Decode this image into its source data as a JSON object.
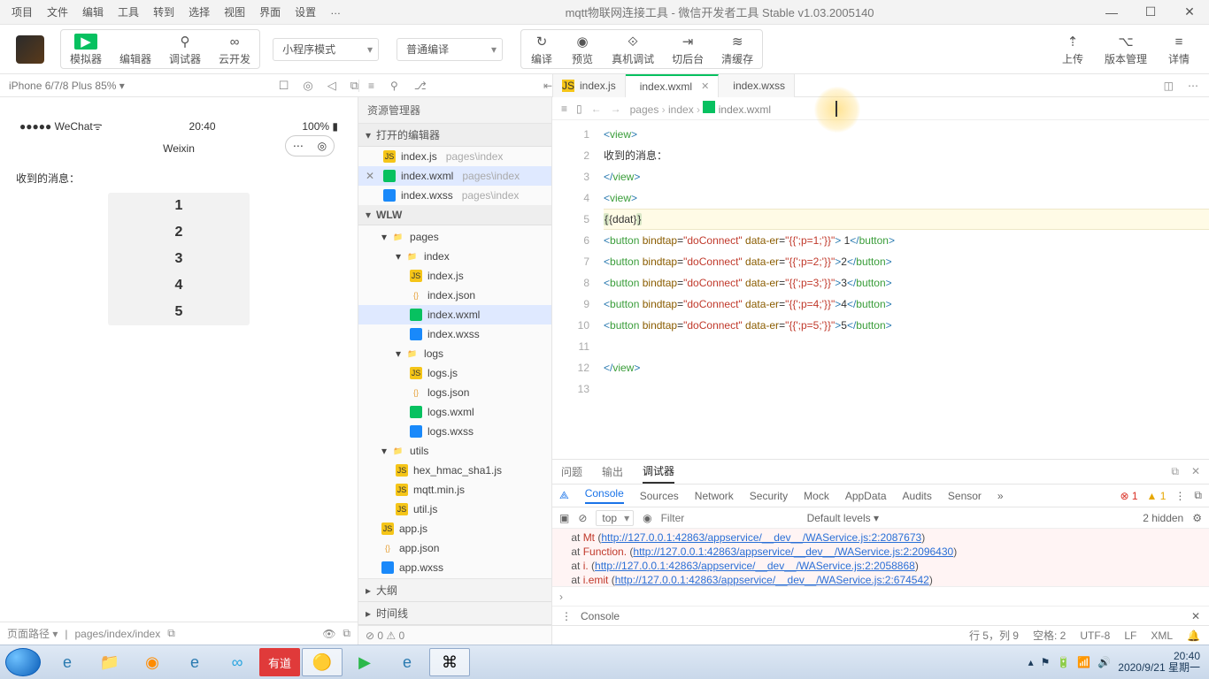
{
  "menu": [
    "项目",
    "文件",
    "编辑",
    "工具",
    "转到",
    "选择",
    "视图",
    "界面",
    "设置",
    "…"
  ],
  "window_title": "mqtt物联网连接工具 - 微信开发者工具 Stable v1.03.2005140",
  "toolbar_main": [
    {
      "icon": "▶",
      "label": "模拟器",
      "green": true
    },
    {
      "icon": "</>",
      "label": "编辑器"
    },
    {
      "icon": "⚲",
      "label": "调试器"
    },
    {
      "icon": "∞",
      "label": "云开发"
    }
  ],
  "combo_mode": "小程序模式",
  "combo_compile": "普通编译",
  "toolbar_mid": [
    {
      "icon": "↻",
      "label": "编译"
    },
    {
      "icon": "◉",
      "label": "预览"
    },
    {
      "icon": "⟐",
      "label": "真机调试"
    },
    {
      "icon": "⇥",
      "label": "切后台"
    },
    {
      "icon": "≋",
      "label": "清缓存"
    }
  ],
  "toolbar_right": [
    {
      "icon": "⇡",
      "label": "上传"
    },
    {
      "icon": "⌥",
      "label": "版本管理"
    },
    {
      "icon": "≡",
      "label": "详情"
    }
  ],
  "device": "iPhone 6/7/8 Plus 85% ▾",
  "tabs": [
    {
      "name": "index.js",
      "icon": "js",
      "active": false,
      "close": false
    },
    {
      "name": "index.wxml",
      "icon": "wxml",
      "active": true,
      "close": true
    },
    {
      "name": "index.wxss",
      "icon": "wxss",
      "active": false,
      "close": false
    }
  ],
  "sim": {
    "signal": "●●●●●",
    "carrier": "WeChat",
    "wifi": "ᯤ",
    "time": "20:40",
    "battery": "100%",
    "batt_icon": "▮▮",
    "title": "Weixin",
    "body_label": "收到的消息：",
    "buttons": [
      "1",
      "2",
      "3",
      "4",
      "5"
    ]
  },
  "page_path_label": "页面路径 ▾",
  "page_path": "pages/index/index",
  "explorer": {
    "title": "资源管理器",
    "open_editors": "打开的编辑器",
    "open_items": [
      {
        "name": "index.js",
        "icon": "js",
        "path": "pages\\index"
      },
      {
        "name": "index.wxml",
        "icon": "wxml",
        "path": "pages\\index",
        "sel": true,
        "close": true
      },
      {
        "name": "index.wxss",
        "icon": "wxss",
        "path": "pages\\index"
      }
    ],
    "project": "WLW",
    "outline": "大纲",
    "timeline": "时间线",
    "status": "⊘ 0 ⚠ 0"
  },
  "tree": [
    {
      "d": 0,
      "t": "folder-open",
      "icon": "pages",
      "n": "pages"
    },
    {
      "d": 1,
      "t": "folder-open",
      "icon": "folder",
      "n": "index"
    },
    {
      "d": 2,
      "t": "file",
      "icon": "js",
      "n": "index.js"
    },
    {
      "d": 2,
      "t": "file",
      "icon": "json",
      "n": "index.json"
    },
    {
      "d": 2,
      "t": "file",
      "icon": "wxml",
      "n": "index.wxml",
      "sel": true
    },
    {
      "d": 2,
      "t": "file",
      "icon": "wxss",
      "n": "index.wxss"
    },
    {
      "d": 1,
      "t": "folder-open",
      "icon": "folder",
      "n": "logs"
    },
    {
      "d": 2,
      "t": "file",
      "icon": "js",
      "n": "logs.js"
    },
    {
      "d": 2,
      "t": "file",
      "icon": "json",
      "n": "logs.json"
    },
    {
      "d": 2,
      "t": "file",
      "icon": "wxml",
      "n": "logs.wxml"
    },
    {
      "d": 2,
      "t": "file",
      "icon": "wxss",
      "n": "logs.wxss"
    },
    {
      "d": 0,
      "t": "folder-open",
      "icon": "folder",
      "n": "utils"
    },
    {
      "d": 1,
      "t": "file",
      "icon": "js",
      "n": "hex_hmac_sha1.js"
    },
    {
      "d": 1,
      "t": "file",
      "icon": "js",
      "n": "mqtt.min.js"
    },
    {
      "d": 1,
      "t": "file",
      "icon": "js",
      "n": "util.js"
    },
    {
      "d": 0,
      "t": "file",
      "icon": "js",
      "n": "app.js"
    },
    {
      "d": 0,
      "t": "file",
      "icon": "json",
      "n": "app.json"
    },
    {
      "d": 0,
      "t": "file",
      "icon": "wxss",
      "n": "app.wxss"
    }
  ],
  "breadcrumb": [
    "pages",
    "index",
    "index.wxml"
  ],
  "code_lines": [
    {
      "n": 1,
      "html": "<span class='tag'>&lt;</span><span class='tagname'>view</span><span class='tag'>&gt;</span>"
    },
    {
      "n": 2,
      "html": "<span class='txt'>收到的消息：</span>"
    },
    {
      "n": 3,
      "html": "<span class='tag'>&lt;/</span><span class='tagname'>view</span><span class='tag'>&gt;</span>"
    },
    {
      "n": 4,
      "html": "<span class='tag'>&lt;</span><span class='tagname'>view</span><span class='tag'>&gt;</span>"
    },
    {
      "n": 5,
      "html": "<span class='brace'>{</span><span class='txt'>{ddat}</span><span class='brace'>}</span>",
      "hl": true
    },
    {
      "n": 6,
      "html": "<span class='tag'>&lt;</span><span class='tagname'>button</span> <span class='attr'>bindtap</span>=<span class='str'>\"doConnect\"</span> <span class='attr'>data-er</span>=<span class='str'>\"{{';p=1;'}}\"</span><span class='tag'>&gt;</span> 1<span class='tag'>&lt;/</span><span class='tagname'>button</span><span class='tag'>&gt;</span>"
    },
    {
      "n": 7,
      "html": "<span class='tag'>&lt;</span><span class='tagname'>button</span> <span class='attr'>bindtap</span>=<span class='str'>\"doConnect\"</span> <span class='attr'>data-er</span>=<span class='str'>\"{{';p=2;'}}\"</span><span class='tag'>&gt;</span>2<span class='tag'>&lt;/</span><span class='tagname'>button</span><span class='tag'>&gt;</span>"
    },
    {
      "n": 8,
      "html": "<span class='tag'>&lt;</span><span class='tagname'>button</span> <span class='attr'>bindtap</span>=<span class='str'>\"doConnect\"</span> <span class='attr'>data-er</span>=<span class='str'>\"{{';p=3;'}}\"</span><span class='tag'>&gt;</span>3<span class='tag'>&lt;/</span><span class='tagname'>button</span><span class='tag'>&gt;</span>"
    },
    {
      "n": 9,
      "html": "<span class='tag'>&lt;</span><span class='tagname'>button</span> <span class='attr'>bindtap</span>=<span class='str'>\"doConnect\"</span> <span class='attr'>data-er</span>=<span class='str'>\"{{';p=4;'}}\"</span><span class='tag'>&gt;</span>4<span class='tag'>&lt;/</span><span class='tagname'>button</span><span class='tag'>&gt;</span>"
    },
    {
      "n": 10,
      "html": "<span class='tag'>&lt;</span><span class='tagname'>button</span> <span class='attr'>bindtap</span>=<span class='str'>\"doConnect\"</span> <span class='attr'>data-er</span>=<span class='str'>\"{{';p=5;'}}\"</span><span class='tag'>&gt;</span>5<span class='tag'>&lt;/</span><span class='tagname'>button</span><span class='tag'>&gt;</span>"
    },
    {
      "n": 11,
      "html": ""
    },
    {
      "n": 12,
      "html": "<span class='tag'>&lt;/</span><span class='tagname'>view</span><span class='tag'>&gt;</span>"
    },
    {
      "n": 13,
      "html": ""
    }
  ],
  "bottom_tabs": {
    "problems": "问题",
    "output": "输出",
    "debugger": "调试器"
  },
  "devtools": {
    "tabs": [
      "Console",
      "Sources",
      "Network",
      "Security",
      "Mock",
      "AppData",
      "Audits",
      "Sensor"
    ],
    "err_count": "1",
    "warn_count": "1",
    "context": "top",
    "filter_ph": "Filter",
    "levels": "Default levels ▾",
    "hidden": "2 hidden",
    "lines": [
      {
        "pre": "at ",
        "fn": "Mt",
        "url": "http://127.0.0.1:42863/appservice/__dev__/WAService.js:2:2087673"
      },
      {
        "pre": "at ",
        "fn": "Function.<anonymous>",
        "url": "http://127.0.0.1:42863/appservice/__dev__/WAService.js:2:2096430"
      },
      {
        "pre": "at ",
        "fn": "i.<anonymous>",
        "url": "http://127.0.0.1:42863/appservice/__dev__/WAService.js:2:2058868"
      },
      {
        "pre": "at ",
        "fn": "i.emit",
        "url": "http://127.0.0.1:42863/appservice/__dev__/WAService.js:2:674542"
      }
    ],
    "footer": "Console"
  },
  "status": {
    "pos": "行 5，列 9",
    "spaces": "空格: 2",
    "enc": "UTF-8",
    "eol": "LF",
    "lang": "XML"
  },
  "taskbar": {
    "icons": [
      "IE",
      "📁",
      "▶",
      "e",
      "○",
      "有道",
      "chrome",
      "▶",
      "e",
      "⌘"
    ],
    "time": "20:40",
    "date": "2020/9/21 星期一"
  }
}
